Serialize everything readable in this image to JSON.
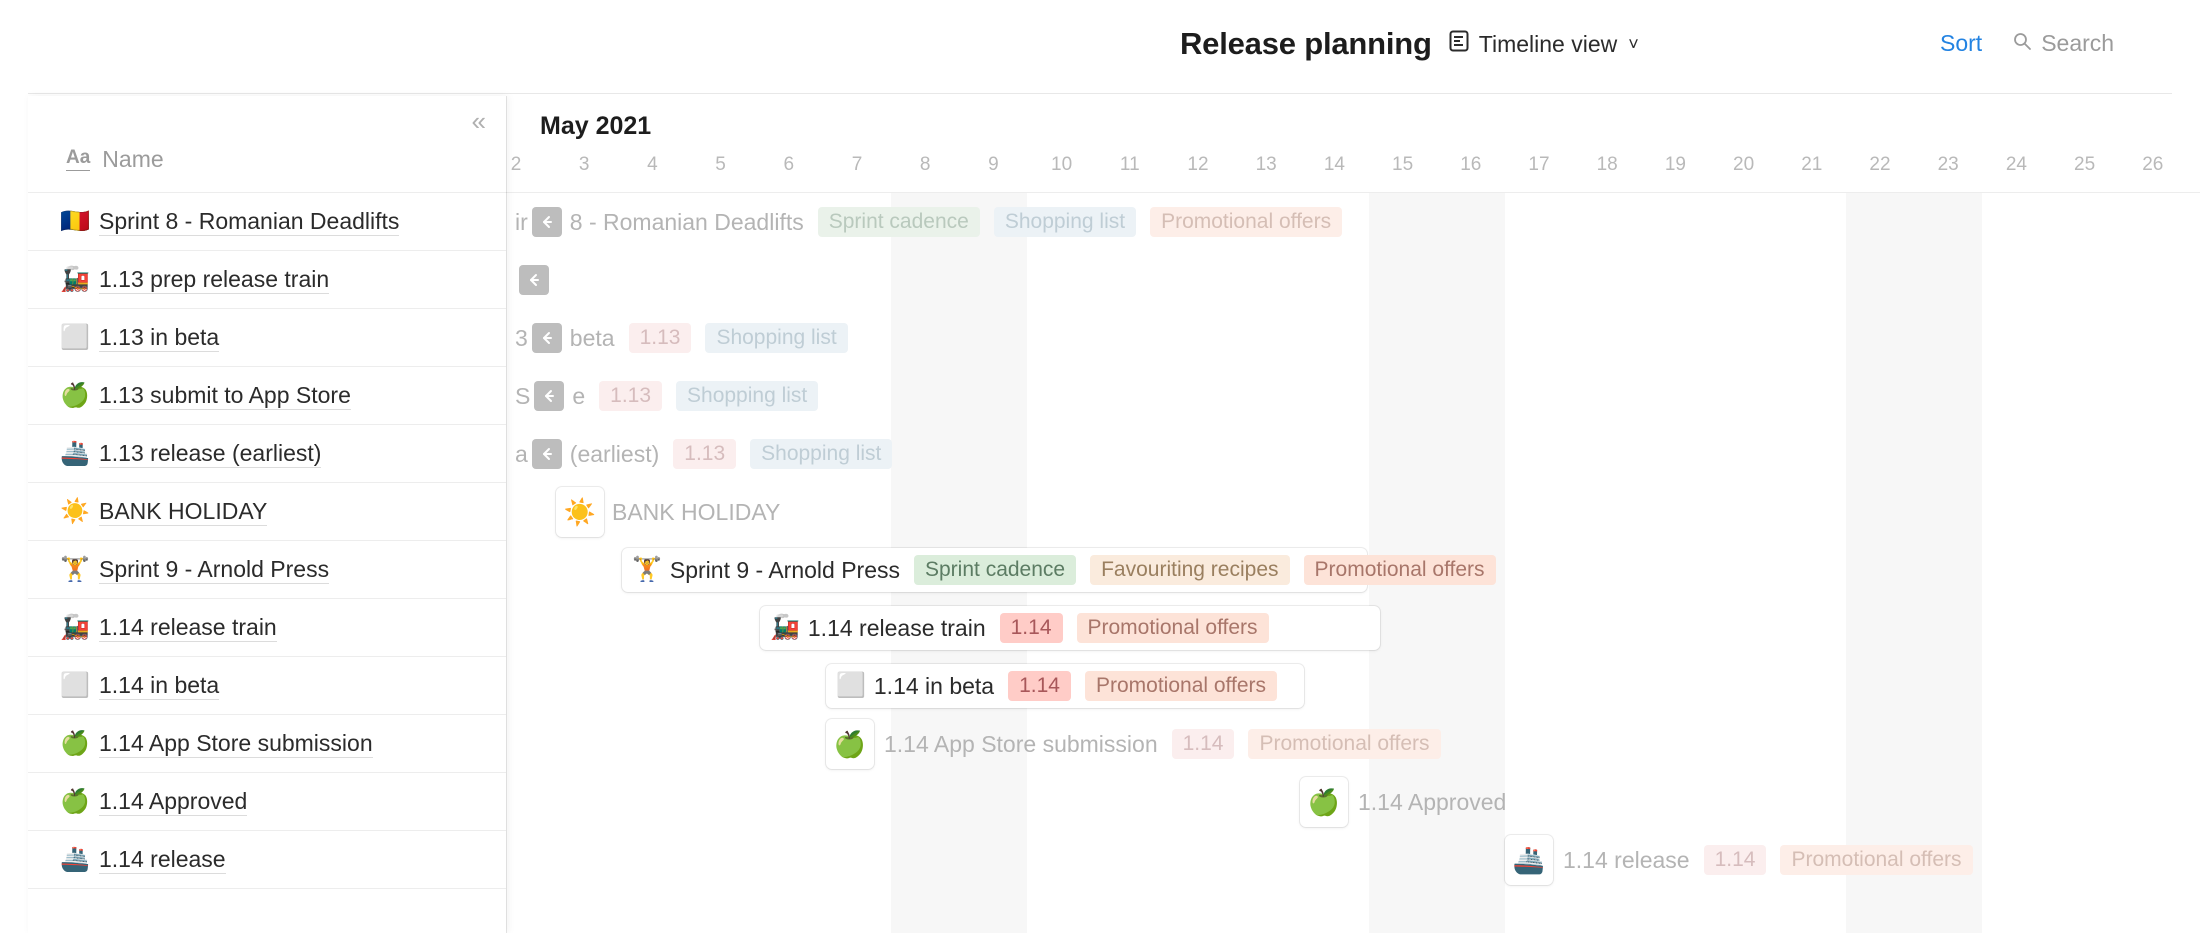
{
  "header": {
    "title": "Release planning",
    "view_name": "Timeline view",
    "view_icon": "timeline-view-icon",
    "chevron": "˅",
    "sort_label": "Sort",
    "search_label": "Search",
    "search_icon": "search-icon",
    "sort_color": "#2383e2"
  },
  "sidebar": {
    "collapse_icon": "«",
    "column_icon": "Aa",
    "column_label": "Name",
    "items": [
      {
        "emoji": "🇷🇴",
        "label": "Sprint 8 - Romanian Deadlifts"
      },
      {
        "emoji": "🚂",
        "label": "1.13 prep release train"
      },
      {
        "emoji": "⬜",
        "label": "1.13 in beta"
      },
      {
        "emoji": "🍏",
        "label": "1.13 submit to App Store"
      },
      {
        "emoji": "🚢",
        "label": "1.13 release (earliest)"
      },
      {
        "emoji": "☀️",
        "label": "BANK HOLIDAY"
      },
      {
        "emoji": "🏋️",
        "label": "Sprint 9 - Arnold Press"
      },
      {
        "emoji": "🚂",
        "label": "1.14 release train"
      },
      {
        "emoji": "⬜",
        "label": "1.14 in beta"
      },
      {
        "emoji": "🍏",
        "label": "1.14 App Store submission"
      },
      {
        "emoji": "🍏",
        "label": "1.14 Approved"
      },
      {
        "emoji": "🚢",
        "label": "1.14 release"
      }
    ]
  },
  "timeline": {
    "month": "May 2021",
    "days": [
      "2",
      "3",
      "4",
      "5",
      "6",
      "7",
      "8",
      "9",
      "10",
      "11",
      "12",
      "13",
      "14",
      "15",
      "16",
      "17",
      "18",
      "19",
      "20",
      "21",
      "22",
      "23",
      "24",
      "25",
      "26"
    ],
    "weekend_days": [
      "8",
      "9",
      "15",
      "16",
      "22",
      "23"
    ],
    "overflow_icon": "←",
    "bars": [
      {
        "emoji": "🇷🇴",
        "title": "8 - Romanian Deadlifts",
        "title_prefix": "ir",
        "clipped_left": true,
        "tags": [
          {
            "text": "Sprint cadence",
            "color": "green",
            "faded": true
          },
          {
            "text": "Shopping list",
            "color": "blue",
            "faded": true
          },
          {
            "text": "Promotional offers",
            "color": "peach",
            "faded": true
          }
        ]
      },
      {
        "emoji": "",
        "title": "",
        "clipped_left": true,
        "tags": []
      },
      {
        "emoji": "",
        "title": "beta",
        "title_prefix": "3",
        "clipped_left": true,
        "tags": [
          {
            "text": "1.13",
            "color": "pink",
            "faded": true
          },
          {
            "text": "Shopping list",
            "color": "blue",
            "faded": true
          }
        ]
      },
      {
        "emoji": "",
        "title": "e",
        "title_prefix": "S",
        "clipped_left": true,
        "tags": [
          {
            "text": "1.13",
            "color": "pink",
            "faded": true
          },
          {
            "text": "Shopping list",
            "color": "blue",
            "faded": true
          }
        ]
      },
      {
        "emoji": "",
        "title": "(earliest)",
        "title_prefix": "a",
        "clipped_left": true,
        "tags": [
          {
            "text": "1.13",
            "color": "pink",
            "faded": true
          },
          {
            "text": "Shopping list",
            "color": "blue",
            "faded": true
          }
        ]
      },
      {
        "emoji": "☀️",
        "title": "BANK HOLIDAY",
        "tags": []
      },
      {
        "emoji": "🏋️",
        "title": "Sprint 9 - Arnold Press",
        "tags": [
          {
            "text": "Sprint cadence",
            "color": "green"
          },
          {
            "text": "Favouriting recipes",
            "color": "orange"
          },
          {
            "text": "Promotional offers",
            "color": "peach",
            "faded": true
          }
        ]
      },
      {
        "emoji": "🚂",
        "title": "1.14 release train",
        "tags": [
          {
            "text": "1.14",
            "color": "red"
          },
          {
            "text": "Promotional offers",
            "color": "peach"
          }
        ]
      },
      {
        "emoji": "⬜",
        "title": "1.14 in beta",
        "tags": [
          {
            "text": "1.14",
            "color": "red"
          },
          {
            "text": "Promotional offers",
            "color": "peach"
          }
        ]
      },
      {
        "emoji": "🍏",
        "title": "1.14 App Store submission",
        "tags": [
          {
            "text": "1.14",
            "color": "pink",
            "faded": true
          },
          {
            "text": "Promotional offers",
            "color": "peach",
            "faded": true
          }
        ]
      },
      {
        "emoji": "🍏",
        "title": "1.14 Approved",
        "tags": []
      },
      {
        "emoji": "🚢",
        "title": "1.14 release",
        "tags": [
          {
            "text": "1.14",
            "color": "pink",
            "faded": true
          },
          {
            "text": "Promotional offers",
            "color": "peach",
            "faded": true
          }
        ]
      }
    ]
  }
}
